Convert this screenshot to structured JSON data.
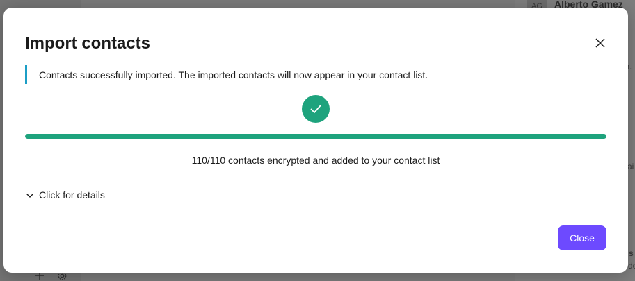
{
  "background": {
    "contact_avatar": "AG",
    "contact_name": "Alberto Gamez",
    "snippets": [
      "m.",
      "ai",
      "s",
      "de"
    ],
    "icons": [
      "plus-icon",
      "gear-icon"
    ]
  },
  "modal": {
    "title": "Import contacts",
    "notice": "Contacts successfully imported. The imported contacts will now appear in your contact list.",
    "progress": {
      "fraction": 1.0,
      "text": "110/110 contacts encrypted and added to your contact list"
    },
    "details_toggle": "Click for details",
    "close_label": "Close",
    "icons": {
      "close": "close-icon",
      "success": "check-icon",
      "toggle": "chevron-down-icon"
    }
  },
  "colors": {
    "accent": "#6d4aff",
    "success": "#1ea37d",
    "notice_border": "#1c9ec6"
  }
}
